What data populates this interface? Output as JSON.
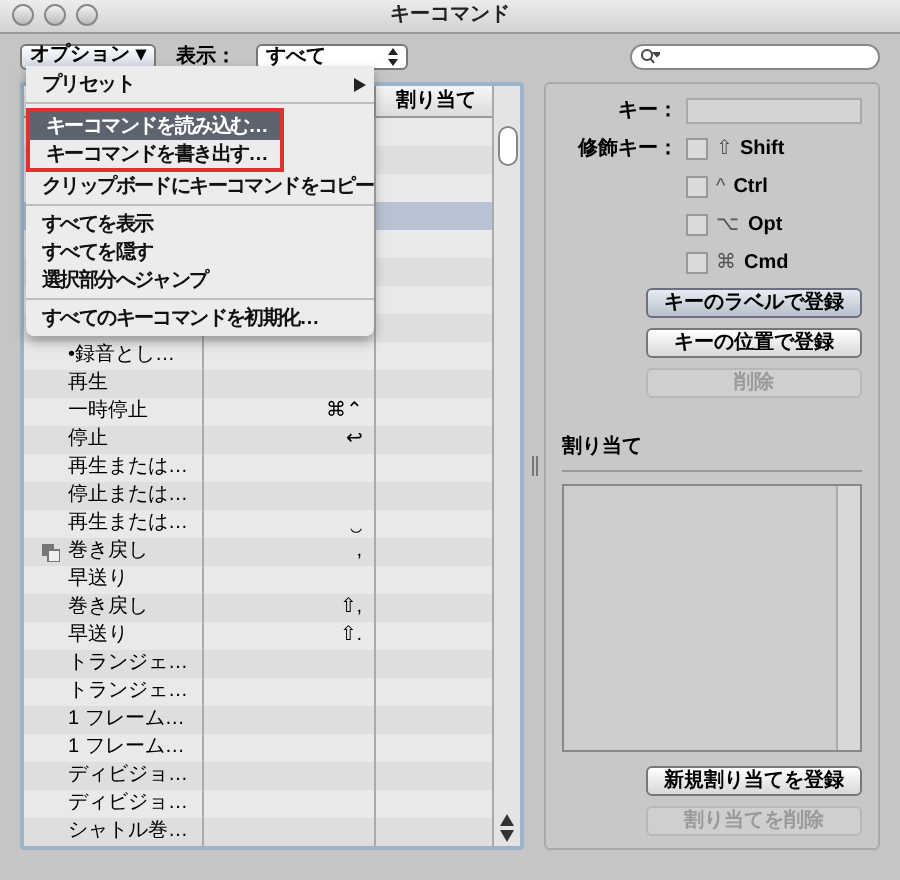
{
  "window": {
    "title": "キーコマンド"
  },
  "toolbar": {
    "options_button": "オプション ▾",
    "view_label": "表示：",
    "view_value": "すべて"
  },
  "menu": {
    "items": [
      {
        "label": "プリセット",
        "submenu": true,
        "selected": false,
        "boxed": false,
        "separator_after": true
      },
      {
        "label": "キーコマンドを読み込む…",
        "submenu": false,
        "selected": true,
        "boxed": true,
        "separator_after": false
      },
      {
        "label": "キーコマンドを書き出す…",
        "submenu": false,
        "selected": false,
        "boxed": true,
        "separator_after": false
      },
      {
        "label": "クリップボードにキーコマンドをコピー",
        "submenu": false,
        "selected": false,
        "boxed": false,
        "separator_after": true
      },
      {
        "label": "すべてを表示",
        "submenu": false,
        "selected": false,
        "boxed": false,
        "separator_after": false
      },
      {
        "label": "すべてを隠す",
        "submenu": false,
        "selected": false,
        "boxed": false,
        "separator_after": false
      },
      {
        "label": "選択部分へジャンプ",
        "submenu": false,
        "selected": false,
        "boxed": false,
        "separator_after": true
      },
      {
        "label": "すべてのキーコマンドを初期化…",
        "submenu": false,
        "selected": false,
        "boxed": false,
        "separator_after": false
      }
    ]
  },
  "table": {
    "columns": [
      {
        "label": "割り当て"
      }
    ],
    "hidden_rows": [
      {
        "selected": false
      },
      {
        "selected": false
      },
      {
        "selected": false
      },
      {
        "selected": true
      },
      {
        "selected": false
      },
      {
        "selected": false
      },
      {
        "selected": false
      },
      {
        "selected": false
      }
    ],
    "rows": [
      {
        "name": "•録音とし…",
        "key": "",
        "icon": false
      },
      {
        "name": "再生",
        "key": "",
        "icon": false
      },
      {
        "name": "一時停止",
        "key": "⌘⌃",
        "icon": false
      },
      {
        "name": "停止",
        "key": "↩",
        "icon": false
      },
      {
        "name": "再生または…",
        "key": "",
        "icon": false
      },
      {
        "name": "停止または…",
        "key": "",
        "icon": false
      },
      {
        "name": "再生または…",
        "key": "‿",
        "icon": false
      },
      {
        "name": "巻き戻し",
        "key": ",",
        "icon": true
      },
      {
        "name": "早送り",
        "key": "",
        "icon": false
      },
      {
        "name": "巻き戻し",
        "key": "⇧,",
        "icon": false
      },
      {
        "name": "早送り",
        "key": "⇧.",
        "icon": false
      },
      {
        "name": "トランジェ…",
        "key": "",
        "icon": false
      },
      {
        "name": "トランジェ…",
        "key": "",
        "icon": false
      },
      {
        "name": "1 フレーム…",
        "key": "",
        "icon": false
      },
      {
        "name": "1 フレーム…",
        "key": "",
        "icon": false
      },
      {
        "name": "ディビジョ…",
        "key": "",
        "icon": false
      },
      {
        "name": "ディビジョ…",
        "key": "",
        "icon": false
      },
      {
        "name": "シャトル巻…",
        "key": "",
        "icon": false
      }
    ]
  },
  "key_panel": {
    "key_label": "キー：",
    "modifier_label": "修飾キー：",
    "modifiers": [
      {
        "symbol": "⇧",
        "label": "Shift",
        "checked": false
      },
      {
        "symbol": "^",
        "label": "Ctrl",
        "checked": false
      },
      {
        "symbol": "⌥",
        "label": "Opt",
        "checked": false
      },
      {
        "symbol": "⌘",
        "label": "Cmd",
        "checked": false
      }
    ],
    "buttons": [
      {
        "label": "キーのラベルで登録",
        "disabled": false,
        "selected": true
      },
      {
        "label": "キーの位置で登録",
        "disabled": false,
        "selected": false
      },
      {
        "label": "削除",
        "disabled": true,
        "selected": false
      }
    ]
  },
  "assignments": {
    "title": "割り当て",
    "buttons": [
      {
        "label": "新規割り当てを登録",
        "disabled": false
      },
      {
        "label": "割り当てを削除",
        "disabled": true
      }
    ]
  }
}
